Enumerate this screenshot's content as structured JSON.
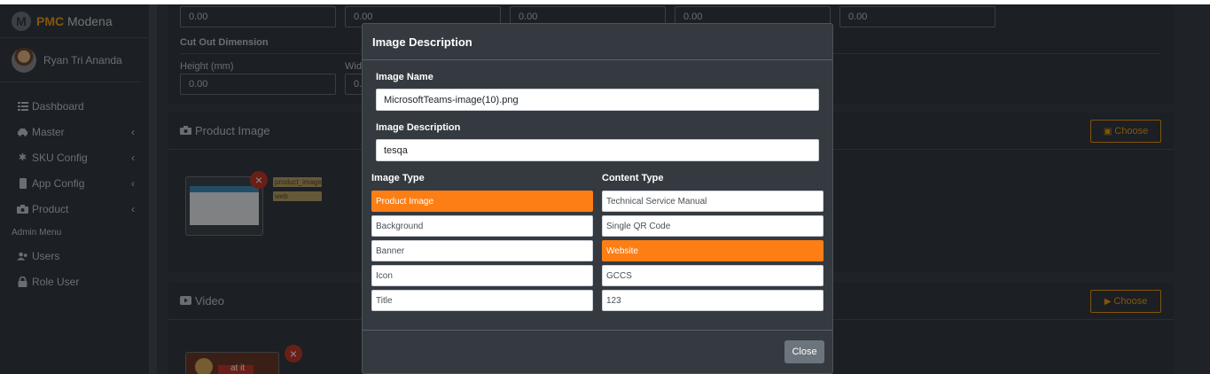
{
  "brand": {
    "strong": "PMC",
    "rest": " Modena",
    "logo_letter": "M"
  },
  "user": {
    "name": "Ryan Tri Ananda"
  },
  "nav": {
    "dashboard": "Dashboard",
    "master": "Master",
    "sku_config": "SKU Config",
    "app_config": "App Config",
    "product": "Product",
    "admin_header": "Admin Menu",
    "users": "Users",
    "role_user": "Role User",
    "chevron": "‹"
  },
  "form": {
    "top_values": [
      "0.00",
      "0.00",
      "0.00",
      "0.00",
      "0.00"
    ],
    "cut_out_title": "Cut Out Dimension",
    "height_label": "Height (mm)",
    "height_value": "0.00",
    "width_label_partial": "Wid",
    "width_value_partial": "0."
  },
  "product_image_card": {
    "title": "Product Image",
    "choose_label": "Choose",
    "tags": [
      "product_image",
      "web"
    ]
  },
  "video_card": {
    "title": "Video",
    "choose_label": "Choose",
    "thumb_caption": "at it"
  },
  "modal": {
    "title": "Image Description",
    "image_name_label": "Image Name",
    "image_name_value": "MicrosoftTeams-image(10).png",
    "image_desc_label": "Image Description",
    "image_desc_value": "tesqa",
    "image_type_label": "Image Type",
    "content_type_label": "Content Type",
    "image_types": [
      {
        "label": "Product Image",
        "selected": true
      },
      {
        "label": "Background",
        "selected": false
      },
      {
        "label": "Banner",
        "selected": false
      },
      {
        "label": "Icon",
        "selected": false
      },
      {
        "label": "Title",
        "selected": false
      }
    ],
    "content_types": [
      {
        "label": "Technical Service Manual",
        "selected": false
      },
      {
        "label": "Single QR Code",
        "selected": false
      },
      {
        "label": "Website",
        "selected": true
      },
      {
        "label": "GCCS",
        "selected": false
      },
      {
        "label": "123",
        "selected": false
      }
    ],
    "close_label": "Close"
  },
  "colors": {
    "accent": "#fd7e14",
    "choose": "#f39c12",
    "sidebar": "#343a40"
  }
}
